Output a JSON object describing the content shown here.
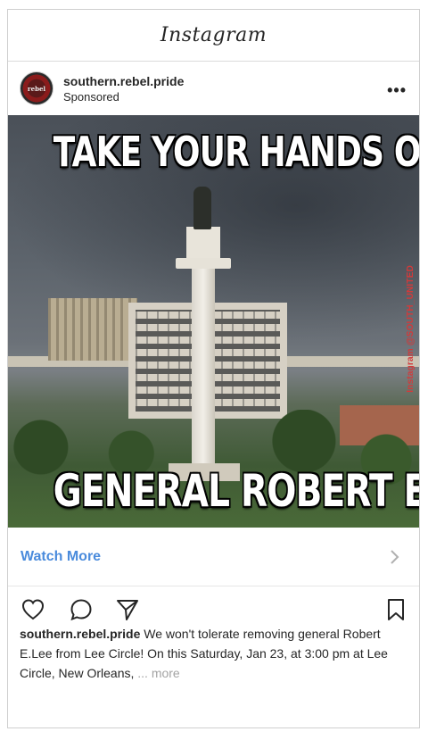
{
  "app": {
    "title": "Instagram"
  },
  "post": {
    "username": "southern.rebel.pride",
    "label": "Sponsored",
    "avatar_text": "rebel",
    "image": {
      "top_text": "TAKE YOUR HANDS OFF",
      "bottom_text": "GENERAL ROBERT E. LEE",
      "watermark": "Instagram @SOUTH_UNITED"
    },
    "cta_label": "Watch More",
    "caption_user": "southern.rebel.pride",
    "caption_text": " We won't tolerate removing general Robert E.Lee from Lee Circle! On this Saturday, Jan 23, at 3:00 pm at Lee Circle, New Orleans, ",
    "caption_more": "... more"
  },
  "icons": [
    "more-options-icon",
    "heart-icon",
    "comment-icon",
    "share-icon",
    "bookmark-icon",
    "chevron-right-icon"
  ],
  "colors": {
    "link": "#4a8bdc",
    "text": "#262626",
    "muted": "#a3a3a3"
  }
}
